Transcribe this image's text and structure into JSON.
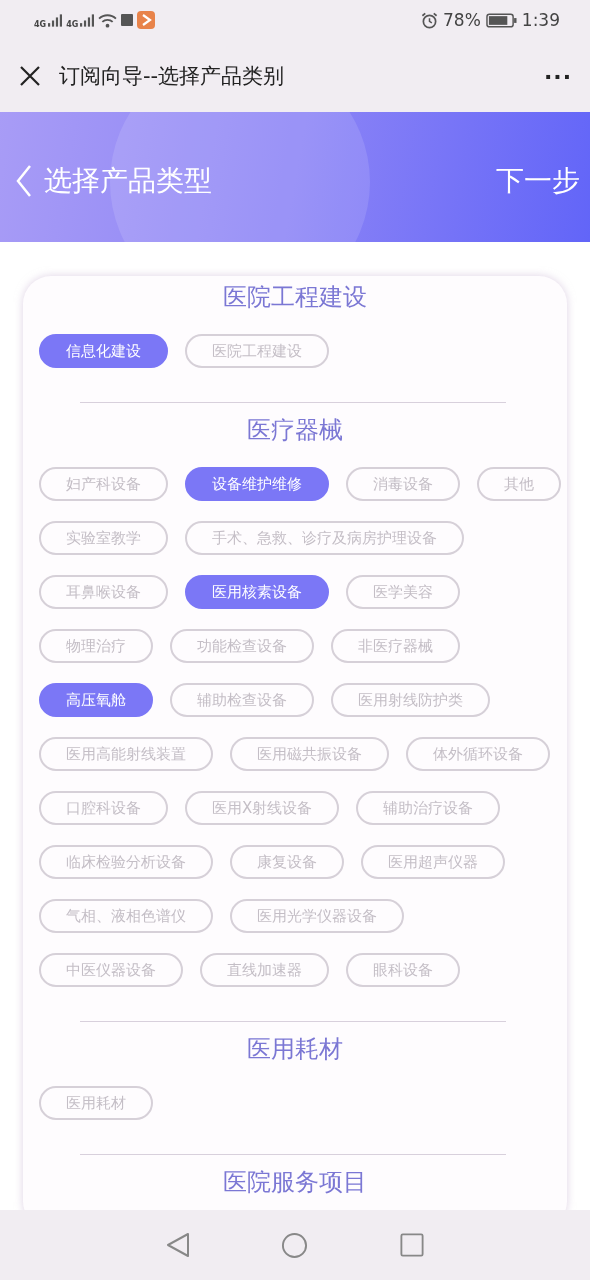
{
  "status_bar": {
    "signal_1": "4G",
    "signal_2": "4G",
    "battery": "78%",
    "time": "1:39"
  },
  "title_bar": {
    "title": "订阅向导--选择产品类别",
    "more": "···"
  },
  "banner": {
    "title": "选择产品类型",
    "next": "下一步"
  },
  "sections": [
    {
      "title": "医院工程建设",
      "tags": [
        {
          "label": "信息化建设",
          "selected": true
        },
        {
          "label": "医院工程建设",
          "selected": false
        }
      ]
    },
    {
      "title": "医疗器械",
      "tags": [
        {
          "label": "妇产科设备",
          "selected": false
        },
        {
          "label": "设备维护维修",
          "selected": true
        },
        {
          "label": "消毒设备",
          "selected": false
        },
        {
          "label": "其他",
          "selected": false
        },
        {
          "label": "实验室教学",
          "selected": false
        },
        {
          "label": "手术、急救、诊疗及病房护理设备",
          "selected": false
        },
        {
          "label": "耳鼻喉设备",
          "selected": false
        },
        {
          "label": "医用核素设备",
          "selected": true
        },
        {
          "label": "医学美容",
          "selected": false
        },
        {
          "label": "物理治疗",
          "selected": false
        },
        {
          "label": "功能检查设备",
          "selected": false
        },
        {
          "label": "非医疗器械",
          "selected": false
        },
        {
          "label": "高压氧舱",
          "selected": true
        },
        {
          "label": "辅助检查设备",
          "selected": false
        },
        {
          "label": "医用射线防护类",
          "selected": false
        },
        {
          "label": "医用高能射线装置",
          "selected": false
        },
        {
          "label": "医用磁共振设备",
          "selected": false
        },
        {
          "label": "体外循环设备",
          "selected": false
        },
        {
          "label": "口腔科设备",
          "selected": false
        },
        {
          "label": "医用X射线设备",
          "selected": false
        },
        {
          "label": "辅助治疗设备",
          "selected": false
        },
        {
          "label": "临床检验分析设备",
          "selected": false
        },
        {
          "label": "康复设备",
          "selected": false
        },
        {
          "label": "医用超声仪器",
          "selected": false
        },
        {
          "label": "气相、液相色谱仪",
          "selected": false
        },
        {
          "label": "医用光学仪器设备",
          "selected": false
        },
        {
          "label": "中医仪器设备",
          "selected": false
        },
        {
          "label": "直线加速器",
          "selected": false
        },
        {
          "label": "眼科设备",
          "selected": false
        }
      ]
    },
    {
      "title": "医用耗材",
      "tags": [
        {
          "label": "医用耗材",
          "selected": false
        }
      ]
    },
    {
      "title": "医院服务项目"
    }
  ]
}
